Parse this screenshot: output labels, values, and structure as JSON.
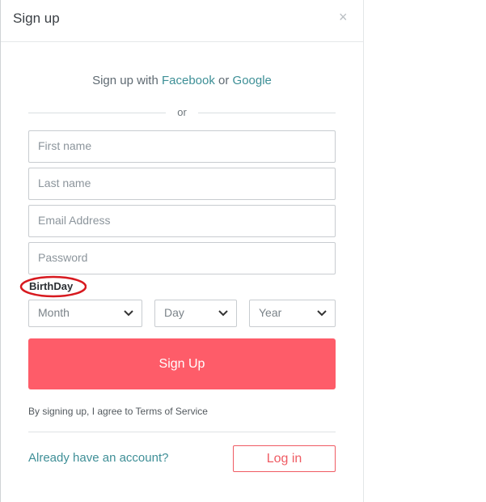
{
  "modal": {
    "title": "Sign up",
    "close_glyph": "×"
  },
  "social": {
    "prefix": "Sign up with",
    "facebook": "Facebook",
    "or": "or",
    "google": "Google"
  },
  "divider": {
    "text": "or"
  },
  "form": {
    "first_name_placeholder": "First name",
    "last_name_placeholder": "Last name",
    "email_placeholder": "Email Address",
    "password_placeholder": "Password",
    "birthday_label": "BirthDay",
    "month": "Month",
    "day": "Day",
    "year": "Year",
    "signup_button": "Sign Up"
  },
  "terms": {
    "prefix": "By signing up, I agree to",
    "link": "Terms of Service"
  },
  "footer": {
    "question": "Already have an account?",
    "login_button": "Log in"
  },
  "colors": {
    "primary": "#fe5c69",
    "link": "#3d8f96",
    "annotation": "#d7191f"
  },
  "icons": {
    "close": "close-icon",
    "select_arrow": "chevron-down-icon"
  }
}
